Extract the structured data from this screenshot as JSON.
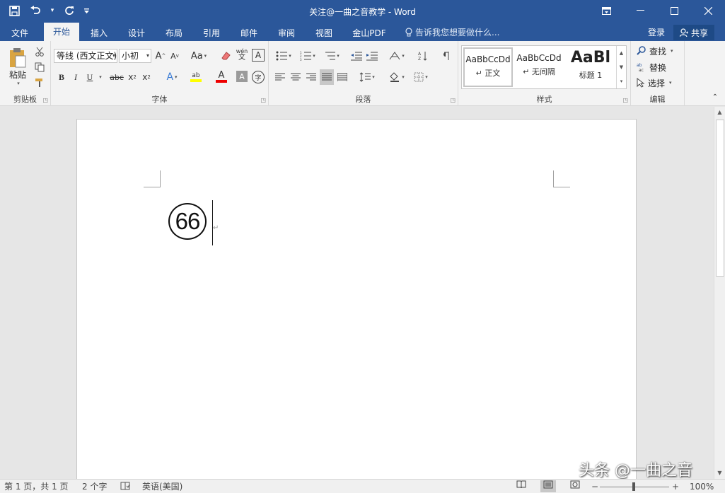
{
  "titlebar": {
    "title": "关注@一曲之音教学 - Word",
    "qat": {
      "save_icon": "save-icon",
      "undo_icon": "undo-icon",
      "redo_icon": "redo-icon"
    }
  },
  "tabs": [
    {
      "label": "文件"
    },
    {
      "label": "开始"
    },
    {
      "label": "插入"
    },
    {
      "label": "设计"
    },
    {
      "label": "布局"
    },
    {
      "label": "引用"
    },
    {
      "label": "邮件"
    },
    {
      "label": "审阅"
    },
    {
      "label": "视图"
    },
    {
      "label": "金山PDF"
    }
  ],
  "tellme": "告诉我您想要做什么...",
  "account": {
    "login": "登录",
    "share": "共享"
  },
  "ribbon": {
    "clipboard": {
      "paste": "粘贴",
      "label": "剪贴板"
    },
    "font": {
      "name": "等线 (西文正文)",
      "size": "小初",
      "grow": "A",
      "shrink": "A",
      "case": "Aa",
      "phonetic": "wén",
      "phonetic_sub": "文",
      "bold": "B",
      "italic": "I",
      "underline": "U",
      "strike": "abc",
      "sub": "x",
      "sup": "x",
      "effects": "A",
      "highlight": "ab",
      "color": "A",
      "shade": "A",
      "enclose": "字",
      "label": "字体"
    },
    "paragraph": {
      "label": "段落"
    },
    "styles": {
      "items": [
        {
          "sample": "AaBbCcDd",
          "name": "↵ 正文"
        },
        {
          "sample": "AaBbCcDd",
          "name": "↵ 无间隔"
        },
        {
          "sample": "AaBl",
          "name": "标题 1"
        }
      ],
      "label": "样式"
    },
    "editing": {
      "find": "查找",
      "replace": "替换",
      "select": "选择",
      "label": "编辑"
    }
  },
  "document": {
    "enclosed_text": "66",
    "para_mark": "↵"
  },
  "watermark": "头条 @一曲之音",
  "status": {
    "page": "第 1 页，共 1 页",
    "words": "2 个字",
    "language": "英语(美国)",
    "zoom": "100%",
    "zoom_minus": "−",
    "zoom_plus": "+"
  }
}
